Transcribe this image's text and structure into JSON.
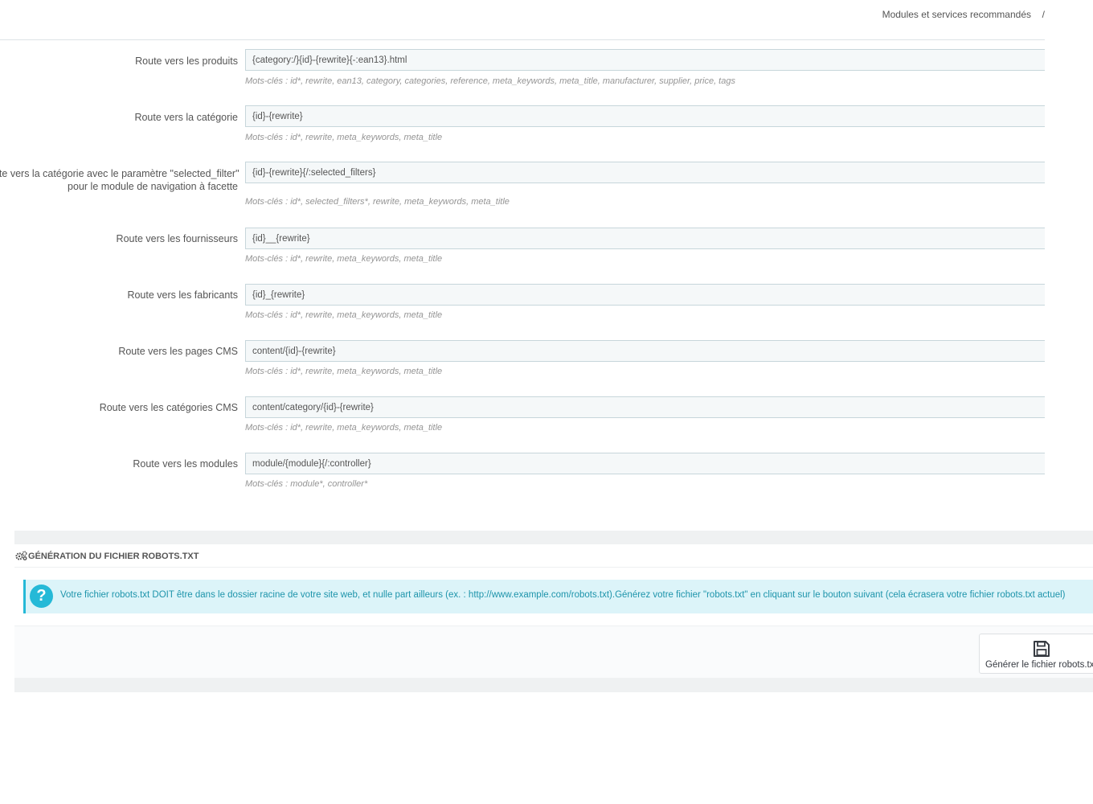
{
  "header": {
    "recommended_link": "Modules et services recommandés",
    "separator": "/"
  },
  "routes": [
    {
      "label": "Route vers les produits",
      "value": "{category:/}{id}-{rewrite}{-:ean13}.html",
      "help": "Mots-clés : id*, rewrite, ean13, category, categories, reference, meta_keywords, meta_title, manufacturer, supplier, price, tags"
    },
    {
      "label": "Route vers la catégorie",
      "value": "{id}-{rewrite}",
      "help": "Mots-clés : id*, rewrite, meta_keywords, meta_title"
    },
    {
      "label_line1": "Route vers la catégorie avec le paramètre \"selected_filter\"",
      "label_line2": "pour le module de navigation à facette",
      "value": "{id}-{rewrite}{/:selected_filters}",
      "help": "Mots-clés : id*, selected_filters*, rewrite, meta_keywords, meta_title"
    },
    {
      "label": "Route vers les fournisseurs",
      "value": "{id}__{rewrite}",
      "help": "Mots-clés : id*, rewrite, meta_keywords, meta_title"
    },
    {
      "label": "Route vers les fabricants",
      "value": "{id}_{rewrite}",
      "help": "Mots-clés : id*, rewrite, meta_keywords, meta_title"
    },
    {
      "label": "Route vers les pages CMS",
      "value": "content/{id}-{rewrite}",
      "help": "Mots-clés : id*, rewrite, meta_keywords, meta_title"
    },
    {
      "label": "Route vers les catégories CMS",
      "value": "content/category/{id}-{rewrite}",
      "help": "Mots-clés : id*, rewrite, meta_keywords, meta_title"
    },
    {
      "label": "Route vers les modules",
      "value": "module/{module}{/:controller}",
      "help": "Mots-clés : module*, controller*"
    }
  ],
  "robots_panel": {
    "heading": "Génération du fichier robots.txt",
    "heading_icon": "cogs-icon",
    "alert_icon": "question-icon",
    "alert_icon_glyph": "?",
    "alert_text": "Votre fichier robots.txt DOIT être dans le dossier racine de votre site web, et nulle part ailleurs (ex. : http://www.example.com/robots.txt).Générez votre fichier \"robots.txt\" en cliquant sur le bouton suivant (cela écrasera votre fichier robots.txt actuel)",
    "button_icon": "save-icon",
    "button_label": "Générer le fichier robots.txt"
  },
  "colors": {
    "accent": "#25b9d7",
    "input_background": "#f5f8f9",
    "help_text": "#959595"
  }
}
